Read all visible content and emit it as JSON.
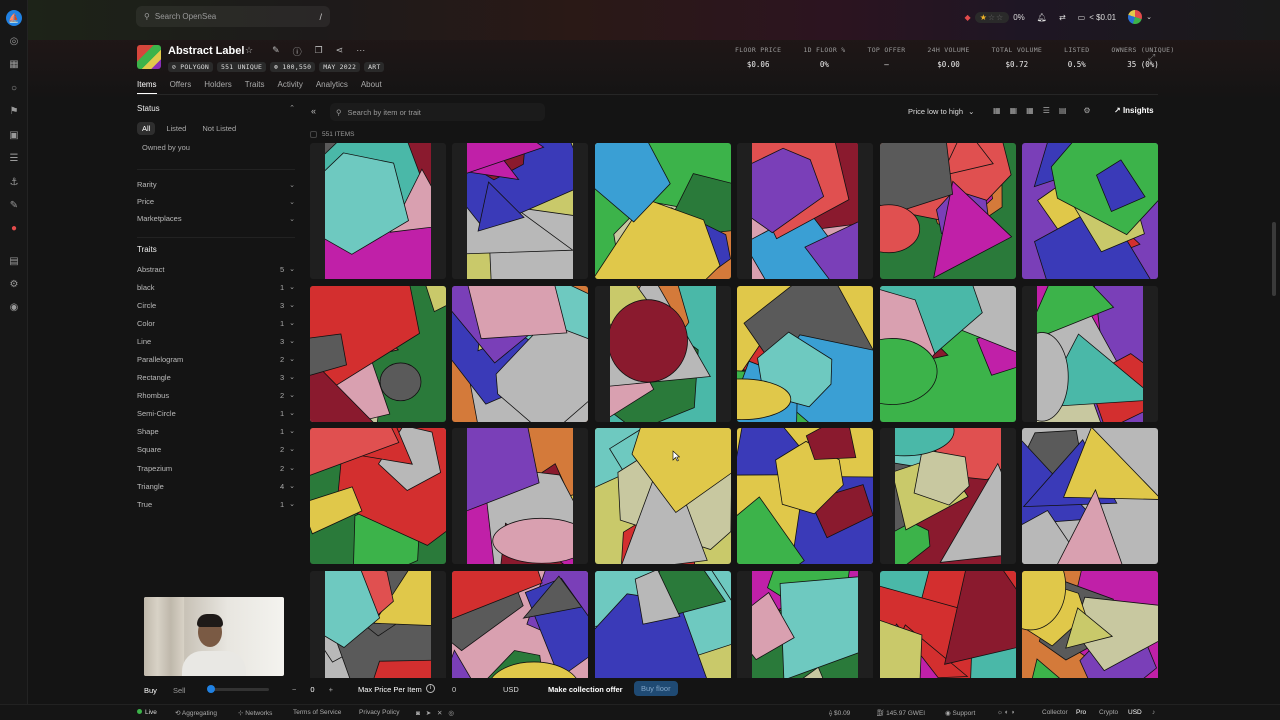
{
  "topbar": {
    "search_placeholder": "Search OpenSea",
    "search_shortcut": "/",
    "rating_percent": "0%",
    "balance": "< $0.01"
  },
  "collection": {
    "name": "Abstract Label",
    "tags": [
      "POLYGON",
      "551 UNIQUE",
      "100,550",
      "MAY 2022",
      "ART"
    ],
    "stats": [
      {
        "label": "FLOOR PRICE",
        "value": "$0.06"
      },
      {
        "label": "1D FLOOR %",
        "value": "0%"
      },
      {
        "label": "TOP OFFER",
        "value": "—"
      },
      {
        "label": "24H VOLUME",
        "value": "$0.00"
      },
      {
        "label": "TOTAL VOLUME",
        "value": "$0.72"
      },
      {
        "label": "LISTED",
        "value": "0.5%"
      },
      {
        "label": "OWNERS (UNIQUE)",
        "value": "35 (0%)"
      }
    ]
  },
  "tabs": [
    "Items",
    "Offers",
    "Holders",
    "Traits",
    "Activity",
    "Analytics",
    "About"
  ],
  "sidebar": {
    "status_label": "Status",
    "status_options": [
      "All",
      "Listed",
      "Not Listed"
    ],
    "owned_label": "Owned by you",
    "filters": [
      "Rarity",
      "Price",
      "Marketplaces"
    ],
    "traits_label": "Traits",
    "traits": [
      {
        "name": "Abstract",
        "count": "5"
      },
      {
        "name": "black",
        "count": "1"
      },
      {
        "name": "Circle",
        "count": "3"
      },
      {
        "name": "Color",
        "count": "1"
      },
      {
        "name": "Line",
        "count": "3"
      },
      {
        "name": "Parallelogram",
        "count": "2"
      },
      {
        "name": "Rectangle",
        "count": "3"
      },
      {
        "name": "Rhombus",
        "count": "2"
      },
      {
        "name": "Semi-Circle",
        "count": "1"
      },
      {
        "name": "Shape",
        "count": "1"
      },
      {
        "name": "Square",
        "count": "2"
      },
      {
        "name": "Trapezium",
        "count": "2"
      },
      {
        "name": "Triangle",
        "count": "4"
      },
      {
        "name": "True",
        "count": "1"
      }
    ]
  },
  "toolbar": {
    "search_placeholder": "Search by item or trait",
    "sort": "Price low to high",
    "insights": "Insights",
    "item_count": "551 ITEMS"
  },
  "buybar": {
    "buy": "Buy",
    "sell": "Sell",
    "quantity": "0",
    "minus": "−",
    "plus": "+",
    "max_price_label": "Max Price Per Item",
    "max_price_value": "0",
    "currency": "USD",
    "make_offer": "Make collection offer",
    "buy_floor": "Buy floor"
  },
  "footer": {
    "live": "Live",
    "aggregating": "Aggregating",
    "networks": "Networks",
    "terms": "Terms of Service",
    "privacy": "Privacy Policy",
    "eth_price": "$0.09",
    "gas": "145.97 GWEI",
    "support": "Support",
    "collector": "Collector",
    "pro": "Pro",
    "crypto": "Crypto",
    "usd": "USD"
  },
  "colors": {
    "accent": "#2081e2",
    "background": "#141414"
  }
}
